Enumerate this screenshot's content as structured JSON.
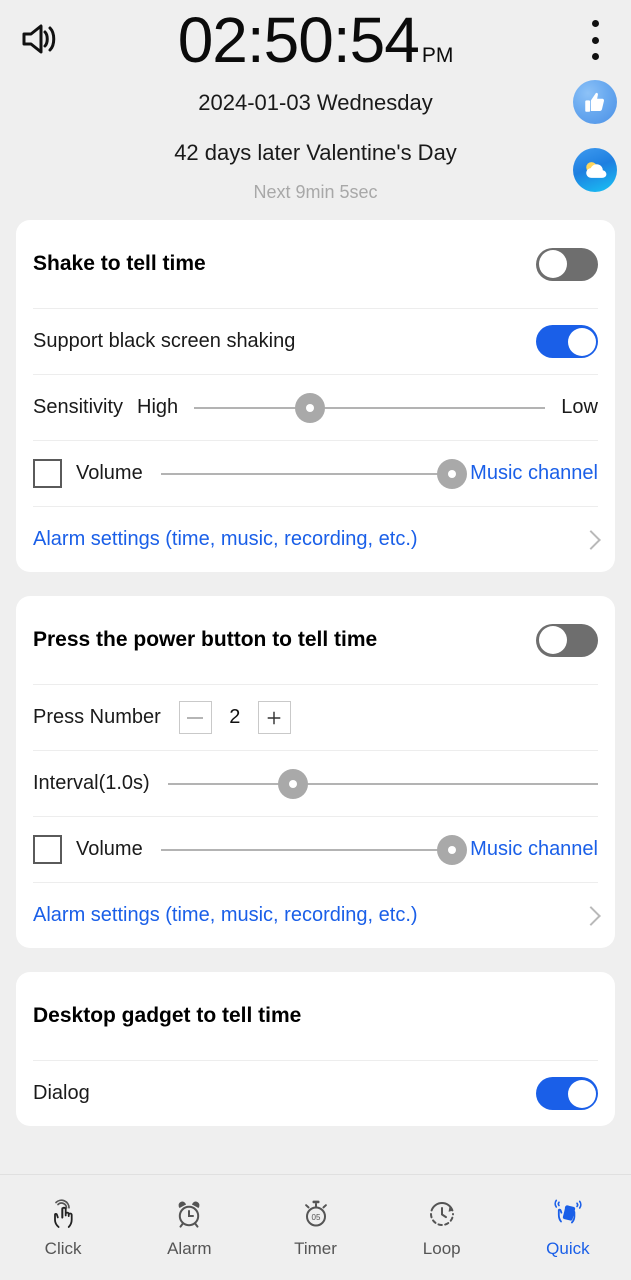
{
  "header": {
    "speaker_icon": "speaker-volume-icon",
    "menu_icon": "overflow-menu-icon",
    "thumb_icon": "thumbs-up-icon",
    "weather_icon": "weather-sun-cloud-icon",
    "time": "02:50:54",
    "ampm": "PM",
    "date": "2024-01-03 Wednesday",
    "festival": "42 days later Valentine's Day",
    "next": "Next  9min 5sec"
  },
  "colors": {
    "accent_blue": "#1a5fe8",
    "toggle_off": "#6e6e6e",
    "page_bg": "#efefef",
    "card_bg": "#ffffff",
    "muted_text": "#a8a8a8"
  },
  "cards": [
    {
      "title": "Shake to tell time",
      "toggle": "off",
      "black_screen": {
        "label": "Support black screen shaking",
        "toggle": "on"
      },
      "sensitivity": {
        "label": "Sensitivity",
        "left": "High",
        "right": "Low",
        "percent": 33
      },
      "volume": {
        "label": "Volume",
        "checked": false,
        "percent": 100,
        "channel": "Music channel"
      },
      "alarm_link": "Alarm settings (time, music, recording, etc.)"
    },
    {
      "title": "Press the power button to tell time",
      "toggle": "off",
      "press_number": {
        "label": "Press Number",
        "minus": "–",
        "value": "2",
        "plus": "+"
      },
      "interval": {
        "label": "Interval(1.0s)",
        "percent": 29
      },
      "volume": {
        "label": "Volume",
        "checked": false,
        "percent": 100,
        "channel": "Music channel"
      },
      "alarm_link": "Alarm settings (time, music, recording, etc.)"
    },
    {
      "title": "Desktop gadget to tell time",
      "dialog": {
        "label": "Dialog",
        "toggle": "on"
      }
    }
  ],
  "bottom_nav": [
    {
      "label": "Click",
      "icon": "tap-hand-icon",
      "active": false
    },
    {
      "label": "Alarm",
      "icon": "alarm-clock-icon",
      "active": false
    },
    {
      "label": "Timer",
      "icon": "stopwatch-icon",
      "active": false
    },
    {
      "label": "Loop",
      "icon": "loop-clock-icon",
      "active": false
    },
    {
      "label": "Quick",
      "icon": "shake-phone-icon",
      "active": true
    }
  ]
}
